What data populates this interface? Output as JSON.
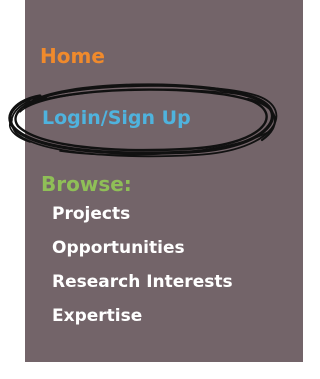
{
  "nav": {
    "home": "Home",
    "login": "Login/Sign Up",
    "browse_heading": "Browse:",
    "browse_items": [
      {
        "label": "Projects"
      },
      {
        "label": "Opportunities"
      },
      {
        "label": "Research Interests"
      },
      {
        "label": "Expertise"
      }
    ]
  },
  "colors": {
    "panel": "#736469",
    "home": "#f08a2c",
    "login": "#4fb3de",
    "browse": "#8fbf57",
    "links": "#ffffff",
    "circle": "#111111"
  },
  "annotation": {
    "shape": "hand-drawn-ellipse",
    "target": "login"
  }
}
